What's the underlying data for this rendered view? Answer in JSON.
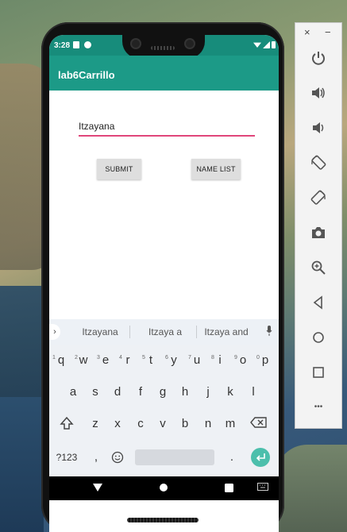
{
  "status_bar": {
    "time": "3:28"
  },
  "app_bar": {
    "title": "lab6Carrillo"
  },
  "form": {
    "name_value": "Itzayana",
    "submit_label": "SUBMIT",
    "name_list_label": "NAME LIST"
  },
  "keyboard": {
    "suggestions": [
      "Itzayana",
      "Itzaya a",
      "Itzaya and"
    ],
    "row1": [
      "q",
      "w",
      "e",
      "r",
      "t",
      "y",
      "u",
      "i",
      "o",
      "p"
    ],
    "row1_hints": [
      "1",
      "2",
      "3",
      "4",
      "5",
      "6",
      "7",
      "8",
      "9",
      "0"
    ],
    "row2": [
      "a",
      "s",
      "d",
      "f",
      "g",
      "h",
      "j",
      "k",
      "l"
    ],
    "row3": [
      "z",
      "x",
      "c",
      "v",
      "b",
      "n",
      "m"
    ],
    "symbols_label": "?123",
    "comma": ",",
    "period": "."
  },
  "side_panel": {
    "close": "×",
    "minimize": "−",
    "more": "•••"
  },
  "colors": {
    "status_bar": "#178c7b",
    "app_bar": "#1c9a87",
    "input_underline": "#e0467a",
    "enter_key": "#4cbfac"
  },
  "icons": [
    "power-icon",
    "volume-up-icon",
    "volume-down-icon",
    "rotate-left-icon",
    "rotate-right-icon",
    "camera-icon",
    "zoom-icon",
    "back-icon",
    "home-icon",
    "overview-icon",
    "more-icon"
  ]
}
